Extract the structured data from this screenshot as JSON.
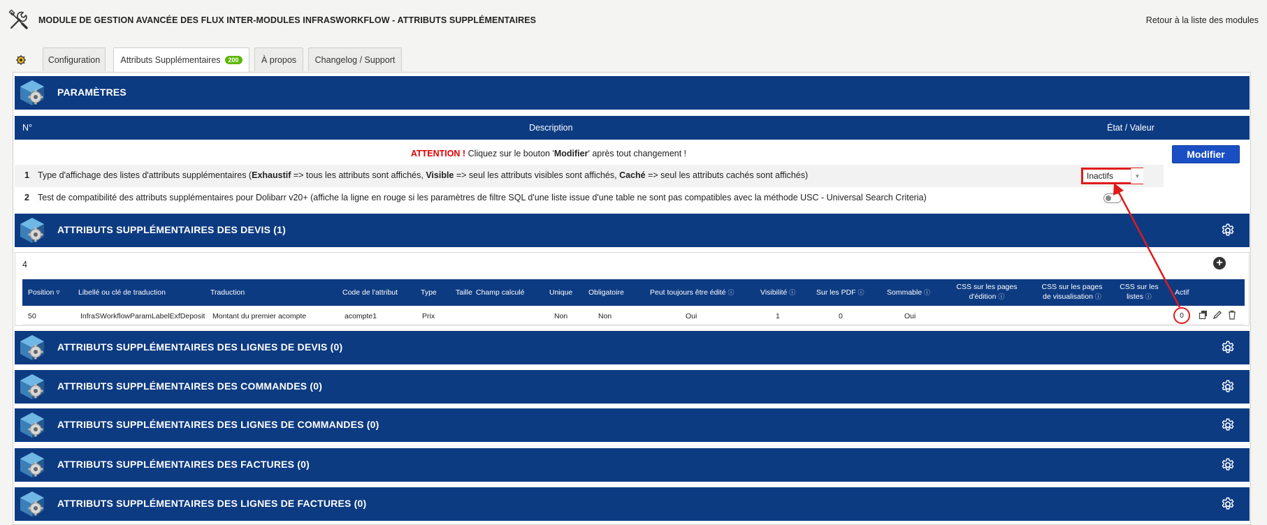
{
  "header": {
    "title": "MODULE DE GESTION AVANCÉE DES FLUX INTER-MODULES INFRASWORKFLOW - ATTRIBUTS SUPPLÉMENTAIRES",
    "back_link": "Retour à la liste des modules"
  },
  "tabs": [
    {
      "label": "Configuration"
    },
    {
      "label": "Attributs Supplémentaires",
      "badge": "200"
    },
    {
      "label": "À propos"
    },
    {
      "label": "Changelog / Support"
    }
  ],
  "params": {
    "title": "PARAMÈTRES",
    "col_num": "N°",
    "col_desc": "Description",
    "col_state": "État / Valeur",
    "warning_prefix": "ATTENTION !",
    "warning_text_1": " Cliquez sur le bouton '",
    "warning_bold": "Modifier",
    "warning_text_2": "' après tout changement !",
    "modify_button": "Modifier",
    "row1": {
      "num": "1",
      "t1": "Type d'affichage des listes d'attributs supplémentaires (",
      "b1": "Exhaustif",
      "t2": " => tous les attributs sont affichés, ",
      "b2": "Visible",
      "t3": " => seul les attributs visibles sont affichés, ",
      "b3": "Caché",
      "t4": " => seul les attributs cachés sont affichés)",
      "select_value": "Inactifs"
    },
    "row2": {
      "num": "2",
      "text": "Test de compatibilité des attributs supplémentaires pour Dolibarr v20+ (affiche la ligne en rouge si les paramètres de filtre SQL d'une liste issue d'une table ne sont pas compatibles avec la méthode USC - Universal Search Criteria)"
    }
  },
  "devis": {
    "title": "ATTRIBUTS SUPPLÉMENTAIRES DES DEVIS (1)",
    "count": "4",
    "columns": {
      "position": "Position",
      "label": "Libellé ou clé de traduction",
      "translation": "Traduction",
      "code": "Code de l'attribut",
      "type": "Type",
      "size": "Taille",
      "computed": "Champ calculé",
      "unique": "Unique",
      "required": "Obligatoire",
      "always_editable": "Peut toujours être édité",
      "visibility": "Visibilité",
      "on_pdf": "Sur les PDF",
      "summable": "Sommable",
      "css_edit_1": "CSS sur les pages",
      "css_edit_2": "d'édition",
      "css_view_1": "CSS sur les pages",
      "css_view_2": "de visualisation",
      "css_list_1": "CSS sur les",
      "css_list_2": "listes",
      "active": "Actif"
    },
    "row": {
      "position": "50",
      "label": "InfraSWorkflowParamLabelExfDeposit",
      "translation": "Montant du premier acompte",
      "code": "acompte1",
      "type": "Prix",
      "unique": "Non",
      "required": "Non",
      "always_editable": "Oui",
      "visibility": "1",
      "on_pdf": "0",
      "summable": "Oui",
      "active": "0"
    }
  },
  "sections": [
    {
      "title": "ATTRIBUTS SUPPLÉMENTAIRES DES LIGNES DE DEVIS (0)"
    },
    {
      "title": "ATTRIBUTS SUPPLÉMENTAIRES DES COMMANDES (0)"
    },
    {
      "title": "ATTRIBUTS SUPPLÉMENTAIRES DES LIGNES DE COMMANDES (0)"
    },
    {
      "title": "ATTRIBUTS SUPPLÉMENTAIRES DES FACTURES (0)"
    },
    {
      "title": "ATTRIBUTS SUPPLÉMENTAIRES DES LIGNES DE FACTURES (0)"
    }
  ],
  "colors": {
    "section_bg": "#0d3b82",
    "annotation": "#e01a1a",
    "button": "#1a4fc4",
    "badge": "#5bb800"
  },
  "icons": {
    "app": "tools-icon",
    "section": "cube-gear-icon",
    "settings": "gear-icon",
    "add": "plus-circle-icon",
    "clone": "clone-icon",
    "edit": "pencil-icon",
    "delete": "trash-icon",
    "info": "info-icon"
  }
}
